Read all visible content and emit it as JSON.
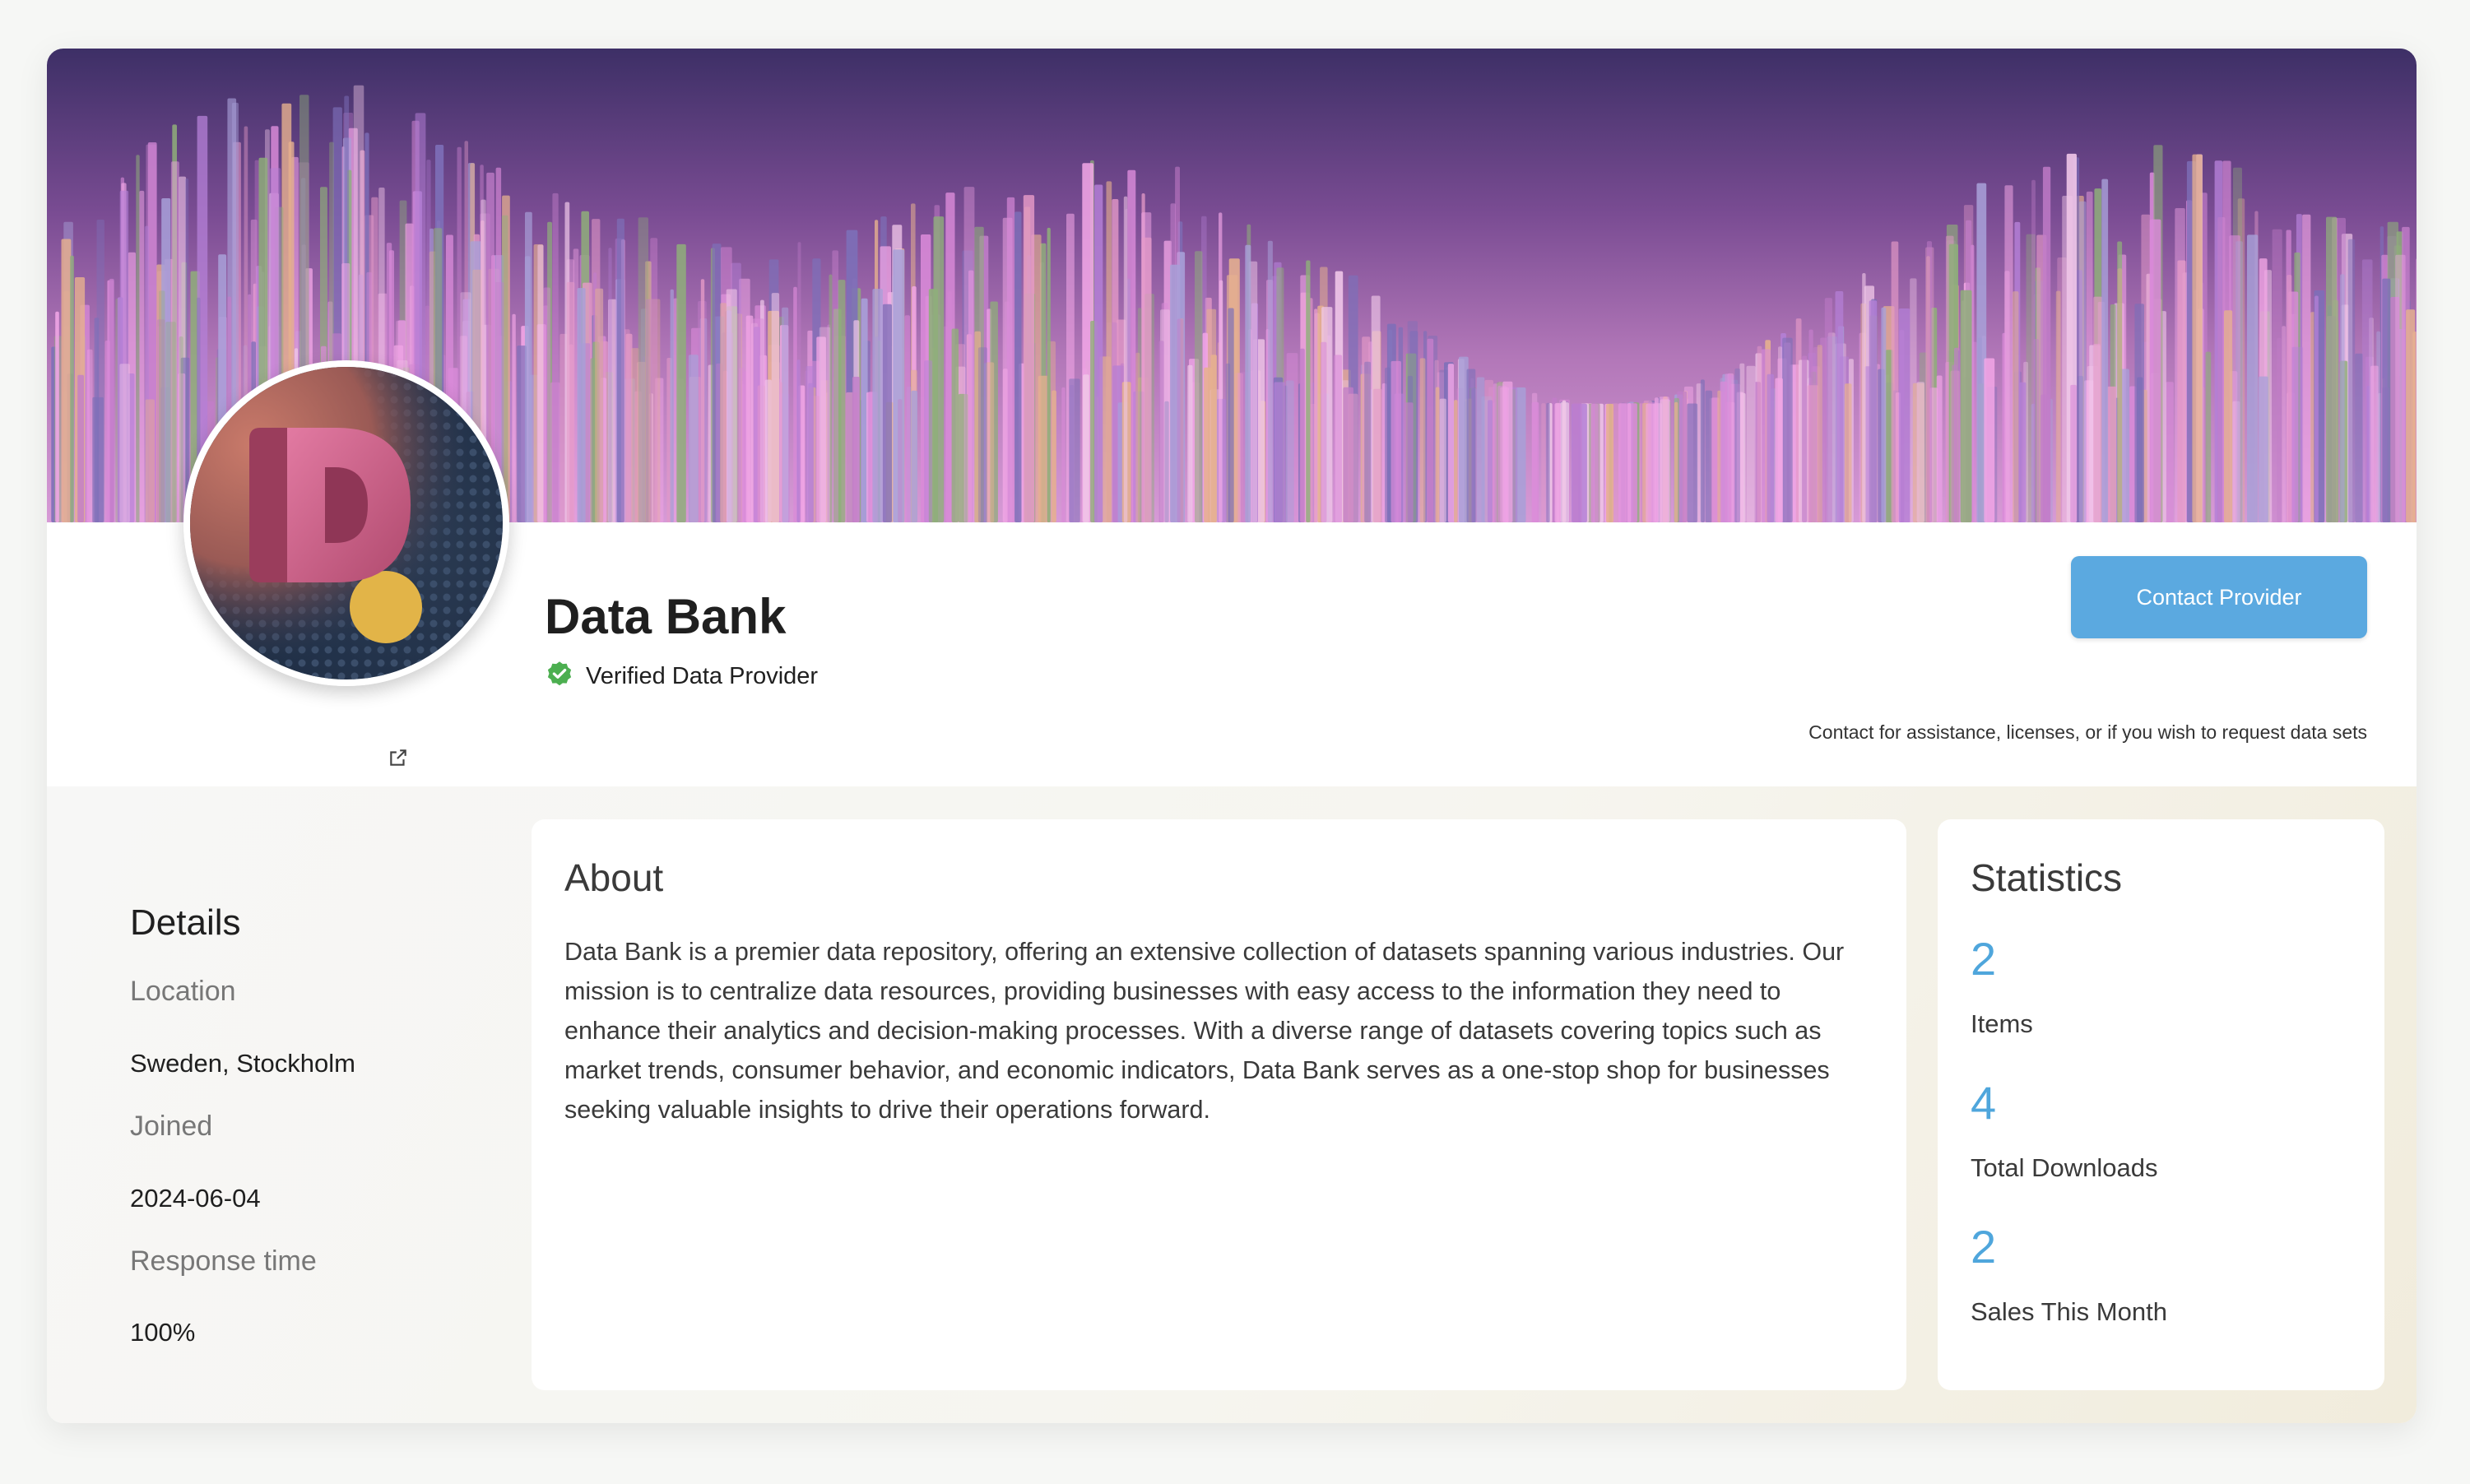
{
  "provider": {
    "name": "Data Bank",
    "verified_label": "Verified Data Provider",
    "avatar_letter": "D"
  },
  "contact": {
    "button_label": "Contact Provider",
    "help_text": "Contact for assistance, licenses, or if you wish to request data sets"
  },
  "details": {
    "title": "Details",
    "fields": [
      {
        "label": "Location",
        "value": "Sweden, Stockholm"
      },
      {
        "label": "Joined",
        "value": "2024-06-04"
      },
      {
        "label": "Response time",
        "value": "100%"
      }
    ]
  },
  "about": {
    "title": "About",
    "text": "Data Bank is a premier data repository, offering an extensive collection of datasets spanning various industries. Our mission is to centralize data resources, providing businesses with easy access to the information they need to enhance their analytics and decision-making processes. With a diverse range of datasets covering topics such as market trends, consumer behavior, and economic indicators, Data Bank serves as a one-stop shop for businesses seeking valuable insights to drive their operations forward."
  },
  "statistics": {
    "title": "Statistics",
    "items": [
      {
        "value": "2",
        "label": "Items"
      },
      {
        "value": "4",
        "label": "Total Downloads"
      },
      {
        "value": "2",
        "label": "Sales This Month"
      }
    ]
  },
  "colors": {
    "accent": "#5ba9e0",
    "stat_number": "#4fa6dc",
    "verified": "#4caf50"
  },
  "icons": {
    "verified": "check-badge-icon",
    "external": "external-link-icon"
  }
}
